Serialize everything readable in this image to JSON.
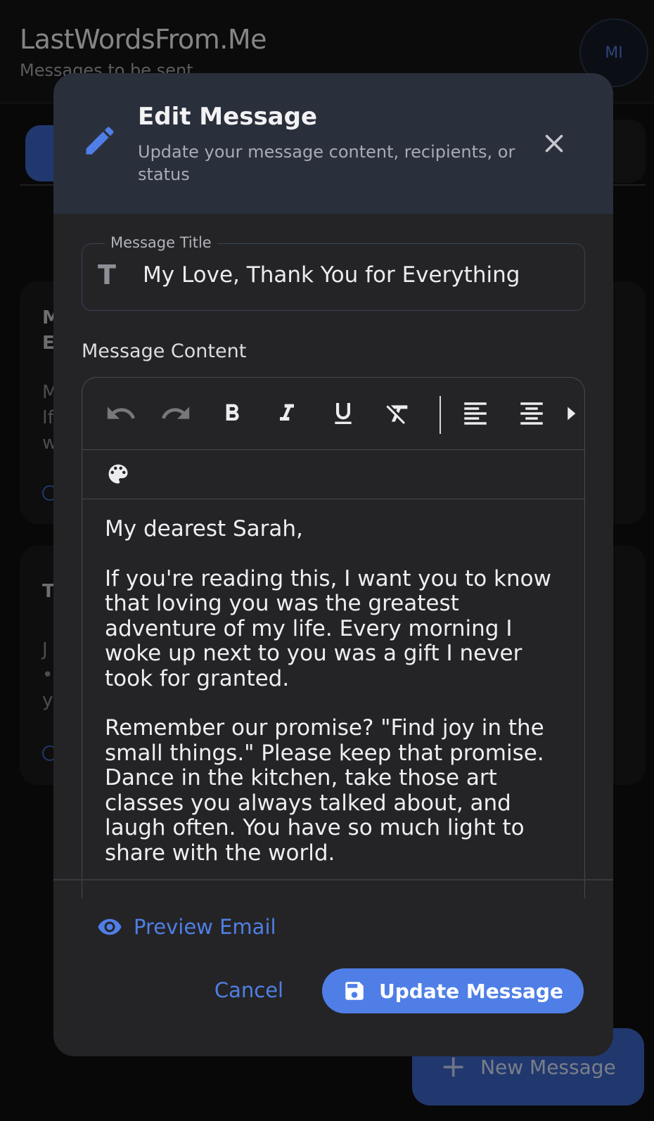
{
  "app": {
    "title": "LastWordsFrom.Me",
    "subtitle": "Messages to be sent",
    "avatar_initials": "MI"
  },
  "background_cards": [
    {
      "title_fragment": "M\nE",
      "preview_fragment": "M\nIf\nw",
      "ellipsis": "..."
    },
    {
      "title_fragment": "T",
      "preview_fragment": "J\n•\ny",
      "ellipsis": "..."
    }
  ],
  "fab": {
    "icon": "plus-icon",
    "label": "New Message"
  },
  "dialog": {
    "icon": "pencil-icon",
    "title": "Edit Message",
    "subtitle": "Update your message content, recipients, or status",
    "close_icon": "close-icon",
    "title_field": {
      "label": "Message Title",
      "icon": "text-t-icon",
      "value": "My Love, Thank You for Everything"
    },
    "content_label": "Message Content",
    "toolbar": [
      "undo-icon",
      "redo-icon",
      "bold-icon",
      "italic-icon",
      "underline-icon",
      "clear-format-icon",
      "align-left-icon",
      "align-center-icon",
      "more-arrow-icon"
    ],
    "toolbar_row2": [
      "palette-icon"
    ],
    "body_paragraphs": [
      "My dearest Sarah,",
      "If you're reading this, I want you to know that loving you was the greatest adventure of my life. Every morning I woke up next to you was a gift I never took for granted.",
      "Remember our promise? \"Find joy in the small things.\" Please keep that promise. Dance in the kitchen, take those art classes you always talked about, and laugh often. You have so much light to share with the world."
    ],
    "preview": {
      "icon": "eye-icon",
      "label": "Preview Email"
    },
    "cancel_label": "Cancel",
    "update": {
      "icon": "save-icon",
      "label": "Update Message"
    }
  },
  "colors": {
    "accent": "#4f7fe6",
    "dialog_bg": "#242426",
    "dialog_header_bg": "#2a2f3c",
    "page_bg": "#0f0f10"
  }
}
